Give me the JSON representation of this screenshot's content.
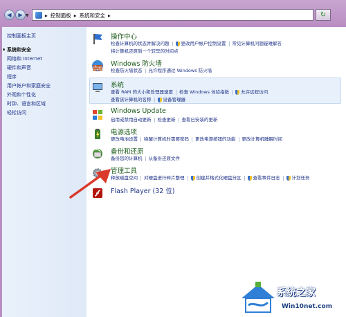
{
  "window": {
    "breadcrumb": [
      "控制面板",
      "系统和安全"
    ],
    "back_icon": "back-arrow-icon",
    "forward_icon": "forward-arrow-icon",
    "refresh_icon": "refresh-icon"
  },
  "sidebar": {
    "home": "控制面板主页",
    "items": [
      {
        "label": "系统和安全",
        "active": true
      },
      {
        "label": "网络和 Internet"
      },
      {
        "label": "硬件和声音"
      },
      {
        "label": "程序"
      },
      {
        "label": "用户帐户和家庭安全"
      },
      {
        "label": "外观和个性化"
      },
      {
        "label": "时钟、语言和区域"
      },
      {
        "label": "轻松访问"
      }
    ]
  },
  "categories": [
    {
      "title": "操作中心",
      "icon": "flag-icon",
      "links": [
        "检查计算机的状态并解决问题",
        "更改用户帐户控制设置",
        "常见计算机问题疑难解答",
        "将计算机还原到一个较早的时间点"
      ]
    },
    {
      "title": "Windows 防火墙",
      "icon": "firewall-icon",
      "links": [
        "检查防火墙状态",
        "允许程序通过 Windows 防火墙"
      ]
    },
    {
      "title": "系统",
      "icon": "system-icon",
      "links": [
        "查看 RAM 的大小和处理器速度",
        "检查 Windows 体验指数",
        "允许远程访问",
        "查看该计算机的名称",
        "设备管理器"
      ]
    },
    {
      "title": "Windows Update",
      "icon": "windows-update-icon",
      "links": [
        "启用或禁用自动更新",
        "检查更新",
        "查看已安装的更新"
      ]
    },
    {
      "title": "电源选项",
      "icon": "power-icon",
      "links": [
        "更改电池设置",
        "唤醒计算机时需要密码",
        "更改电源按钮的功能",
        "更改计算机睡眠时间"
      ]
    },
    {
      "title": "备份和还原",
      "icon": "backup-icon",
      "links": [
        "备份您的计算机",
        "从备份还原文件"
      ]
    },
    {
      "title": "管理工具",
      "icon": "admin-tools-icon",
      "links": [
        "释放磁盘空间",
        "对硬盘进行碎片整理",
        "创建并格式化硬盘分区",
        "查看事件日志",
        "计划任务"
      ]
    },
    {
      "title": "Flash Player (32 位)",
      "icon": "flash-icon",
      "links": []
    }
  ],
  "watermark": {
    "title": "系统之家",
    "url": "Win10net.com"
  },
  "colors": {
    "link": "#1e3287",
    "category_title": "#1e5c1e",
    "arrow": "#d93a2b",
    "sidebar_bg": "#e3ecf8"
  }
}
